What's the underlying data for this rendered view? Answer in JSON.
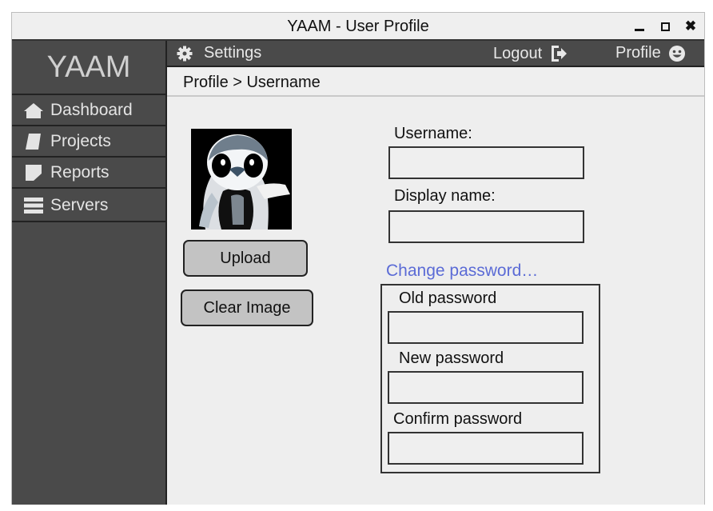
{
  "window": {
    "title": "YAAM - User Profile",
    "controls": {
      "minimize": "minimize",
      "maximize": "maximize",
      "close": "✖"
    }
  },
  "sidebar": {
    "brand": "YAAM",
    "items": [
      {
        "label": "Dashboard",
        "icon": "home-icon"
      },
      {
        "label": "Projects",
        "icon": "folder-icon"
      },
      {
        "label": "Reports",
        "icon": "report-icon"
      },
      {
        "label": "Servers",
        "icon": "server-icon"
      }
    ]
  },
  "topbar": {
    "settings_label": "Settings",
    "logout_label": "Logout",
    "profile_label": "Profile"
  },
  "breadcrumb": "Profile > Username",
  "profile": {
    "upload_label": "Upload",
    "clear_label": "Clear Image",
    "username_label": "Username:",
    "username_value": "",
    "display_name_label": "Display name:",
    "display_name_value": "",
    "change_password_link": "Change password…",
    "old_password_label": "Old password",
    "new_password_label": "New password",
    "confirm_password_label": "Confirm password"
  },
  "colors": {
    "sidebar_bg": "#4a4a4a",
    "content_bg": "#eeeeee",
    "link": "#5b6bd6",
    "button_bg": "#c3c3c3"
  }
}
